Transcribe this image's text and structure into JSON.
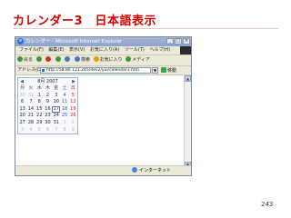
{
  "slide": {
    "title": "カレンダー3　日本語表示",
    "page_number": "243"
  },
  "browser": {
    "window_title": "カレンダー - Microsoft Internet Explorer",
    "window_buttons": [
      "_",
      "□",
      "×"
    ],
    "menu": [
      "ファイル(F)",
      "編集(E)",
      "表示(V)",
      "お気に入り(A)",
      "ツール(T)",
      "ヘルプ(H)"
    ],
    "toolbar": [
      {
        "label": "戻る",
        "icon": "back-arrow-icon",
        "color": "#3a9a3a"
      },
      {
        "label": "",
        "icon": "forward-arrow-icon",
        "color": "#3a9a3a"
      },
      {
        "label": "",
        "icon": "stop-icon",
        "color": "#d03030"
      },
      {
        "label": "",
        "icon": "refresh-icon",
        "color": "#3a9a3a"
      },
      {
        "label": "",
        "icon": "home-icon",
        "color": "#4a78c8"
      },
      {
        "label": "検索",
        "icon": "search-icon",
        "color": "#4a78c8"
      },
      {
        "label": "お気に入り",
        "icon": "favorites-star-icon",
        "color": "#e0a000"
      },
      {
        "label": "メディア",
        "icon": "media-icon",
        "color": "#3a9a3a"
      }
    ],
    "address": {
      "label": "アドレス(D)",
      "url": "http://58.80.121.245/dev2/yui/calendar3.htm",
      "go_label": "移動"
    },
    "status": {
      "zone_label": "インターネット"
    }
  },
  "calendar": {
    "header": "8月 2007",
    "prev_label": "◀",
    "next_label": "▶",
    "weekdays": [
      "月",
      "火",
      "水",
      "木",
      "金",
      "土",
      "日"
    ],
    "weeks": [
      [
        "30",
        "31",
        "1",
        "2",
        "3",
        "4",
        "5"
      ],
      [
        "6",
        "7",
        "8",
        "9",
        "10",
        "11",
        "12"
      ],
      [
        "13",
        "14",
        "15",
        "16",
        "17",
        "18",
        "19"
      ],
      [
        "20",
        "21",
        "22",
        "23",
        "24",
        "25",
        "26"
      ],
      [
        "27",
        "28",
        "29",
        "30",
        "31",
        "1",
        "2"
      ],
      [
        "3",
        "4",
        "5",
        "6",
        "7",
        "8",
        "9"
      ]
    ],
    "today": "17"
  },
  "colors": {
    "title": "#d40000",
    "saturday": "#3355cc",
    "sunday": "#cc2222",
    "other_month": "#b8b8b8"
  }
}
